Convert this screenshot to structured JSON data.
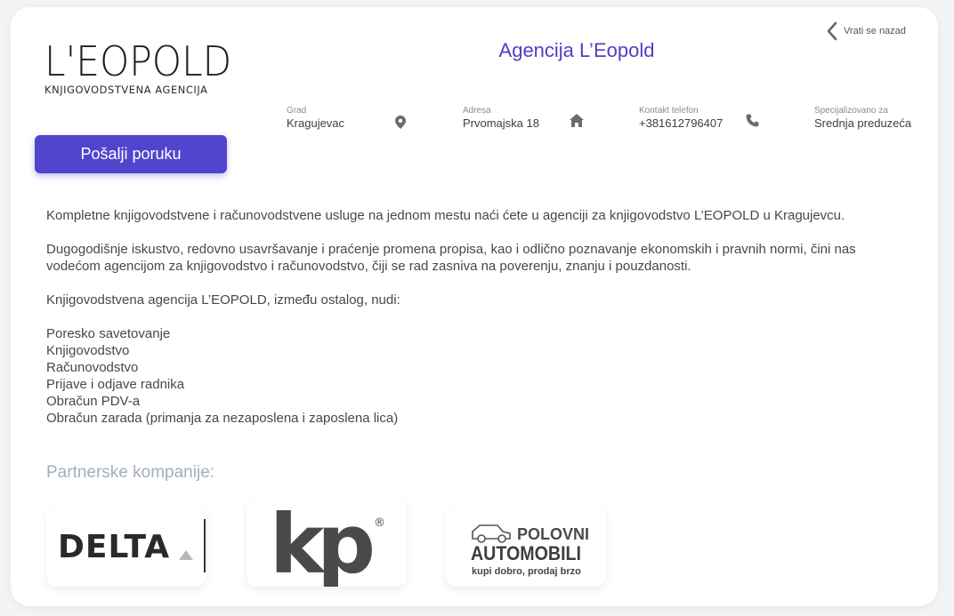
{
  "logo": {
    "main": "L'EOPOLD",
    "sub": "KNJIGOVODSTVENA AGENCIJA"
  },
  "send_button": "Pošalji poruku",
  "title": "Agencija L’Eopold",
  "back": "Vrati se nazad",
  "info": [
    {
      "label": "Grad",
      "value": "Kragujevac",
      "icon": "location-pin-icon"
    },
    {
      "label": "Adresa",
      "value": "Prvomajska 18",
      "icon": "home-icon"
    },
    {
      "label": "Kontakt telefon",
      "value": "+381612796407",
      "icon": "phone-icon"
    },
    {
      "label": "Specijalizovano za",
      "value": "Srednja preduzeća",
      "icon": ""
    }
  ],
  "description": {
    "p1": "Kompletne knjigovodstvene i računovodstvene usluge na jednom mestu naći ćete u agenciji za knjigovodstvo L’EOPOLD u Kragujevcu.",
    "p2": "Dugogodišnje iskustvo, redovno usavršavanje i praćenje promena propisa, kao i odlično poznavanje ekonomskih i pravnih normi, čini nas vodećom agencijom za knjigovodstvo i računovodstvo, čiji se rad zasniva na poverenju, znanju i pouzdanosti.",
    "p3": "Knjigovodstvena agencija L’EOPOLD, između ostalog, nudi:",
    "services": [
      "Poresko savetovanje",
      "Knjigovodstvo",
      "Računovodstvo",
      "Prijave i odjave radnika",
      "Obračun PDV-a",
      "Obračun zarada (primanja za nezaposlena i zaposlena lica)"
    ]
  },
  "partners": {
    "title": "Partnerske kompanije:",
    "items": [
      {
        "name": "DELTA"
      },
      {
        "name": "kp",
        "mark": "®"
      },
      {
        "name": "POLOVNI",
        "name2": "AUTOMOBILI",
        "tagline": "kupi dobro, prodaj brzo"
      }
    ]
  },
  "colors": {
    "accent": "#5145cd",
    "title": "#4d3fc7",
    "partners_title": "#a4aebf"
  }
}
